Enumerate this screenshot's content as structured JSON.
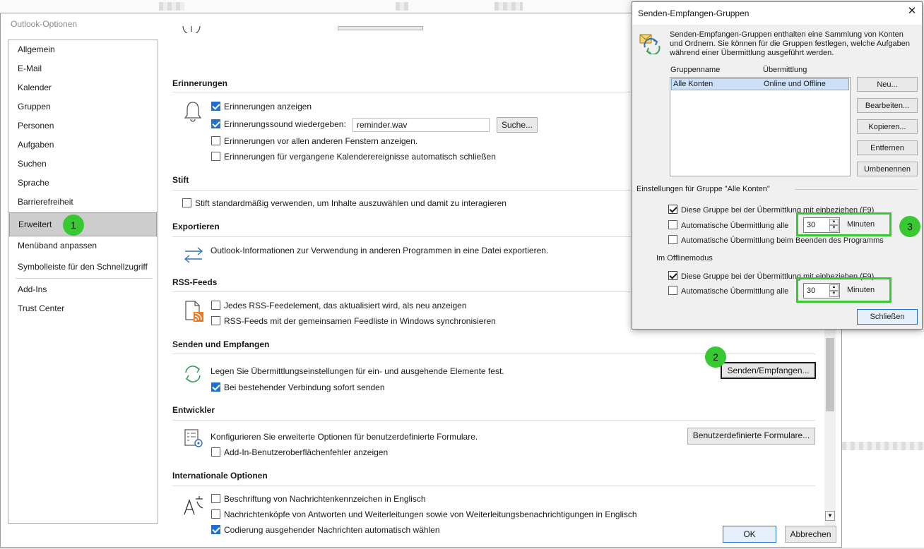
{
  "main_window": {
    "title": "Outlook-Optionen",
    "nav": [
      {
        "label": "Allgemein"
      },
      {
        "label": "E-Mail"
      },
      {
        "label": "Kalender"
      },
      {
        "label": "Gruppen"
      },
      {
        "label": "Personen"
      },
      {
        "label": "Aufgaben"
      },
      {
        "label": "Suchen"
      },
      {
        "label": "Sprache"
      },
      {
        "label": "Barrierefreiheit"
      },
      {
        "label": "Erweitert"
      },
      {
        "label": "Menüband anpassen"
      },
      {
        "label": "Symbolleiste für den Schnellzugriff"
      },
      {
        "label": "Add-Ins"
      },
      {
        "label": "Trust Center"
      }
    ],
    "active_nav": "Erweitert",
    "badges": {
      "b1": "1",
      "b2": "2",
      "b3": "3"
    },
    "sections": {
      "reminders": {
        "title": "Erinnerungen",
        "show": "Erinnerungen anzeigen",
        "sound": "Erinnerungssound wiedergeben:",
        "sound_file": "reminder.wav",
        "browse": "Suche...",
        "on_top": "Erinnerungen vor allen anderen Fenstern anzeigen.",
        "auto_close": "Erinnerungen für vergangene Kalenderereignisse automatisch schließen"
      },
      "pen": {
        "title": "Stift",
        "default": "Stift standardmäßig verwenden, um Inhalte auszuwählen und damit zu interagieren"
      },
      "export": {
        "title": "Exportieren",
        "desc": "Outlook-Informationen zur Verwendung in anderen Programmen in eine Datei exportieren."
      },
      "rss": {
        "title": "RSS-Feeds",
        "new_item": "Jedes RSS-Feedelement, das aktualisiert wird, als neu anzeigen",
        "sync": "RSS-Feeds mit der gemeinsamen Feedliste in Windows synchronisieren"
      },
      "send_receive": {
        "title": "Senden und Empfangen",
        "desc": "Legen Sie Übermittlungseinstellungen für ein- und ausgehende Elemente fest.",
        "button": "Senden/Empfangen...",
        "send_now": "Bei bestehender Verbindung sofort senden"
      },
      "developer": {
        "title": "Entwickler",
        "desc": "Konfigurieren Sie erweiterte Optionen für benutzerdefinierte Formulare.",
        "button": "Benutzerdefinierte Formulare...",
        "addin_errors": "Add-In-Benutzeroberflächenfehler anzeigen"
      },
      "intl": {
        "title": "Internationale Optionen",
        "flags_en": "Beschriftung von Nachrichtenkennzeichen in Englisch",
        "headers_en": "Nachrichtenköpfe von Antworten und Weiterleitungen sowie von Weiterleitungsbenachrichtigungen in Englisch",
        "auto_encoding": "Codierung ausgehender Nachrichten automatisch wählen"
      }
    },
    "ok": "OK",
    "cancel": "Abbrechen"
  },
  "dialog": {
    "title": "Senden-Empfangen-Gruppen",
    "description": "Senden-Empfangen-Gruppen enthalten eine Sammlung von Konten und Ordnern. Sie können für die Gruppen festlegen, welche Aufgaben während einer Übermittlung ausgeführt werden.",
    "col_name": "Gruppenname",
    "col_delivery": "Übermittlung",
    "rows": [
      {
        "name": "Alle Konten",
        "delivery": "Online und Offline"
      }
    ],
    "buttons": {
      "new": "Neu...",
      "edit": "Bearbeiten...",
      "copy": "Kopieren...",
      "remove": "Entfernen",
      "rename": "Umbenennen",
      "close": "Schließen"
    },
    "group_settings_title": "Einstellungen für Gruppe \"Alle Konten\"",
    "include_group": "Diese Gruppe bei der Übermittlung mit einbeziehen (F9)",
    "auto_every": "Automatische Übermittlung alle",
    "interval_online": "30",
    "minutes": "Minuten",
    "auto_on_exit": "Automatische Übermittlung beim Beenden des Programms",
    "offline_title": "Im Offlinemodus",
    "include_group_offline": "Diese Gruppe bei der Übermittlung mit einbeziehen (F9)",
    "auto_every_offline": "Automatische Übermittlung alle",
    "interval_offline": "30",
    "minutes_offline": "Minuten"
  },
  "colors": {
    "highlight": "#38c932",
    "accent": "#1f6fd1"
  }
}
